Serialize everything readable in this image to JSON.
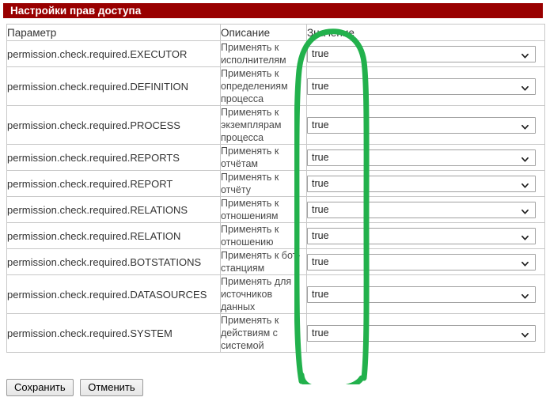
{
  "window": {
    "title": "Настройки прав доступа"
  },
  "table": {
    "headers": {
      "parameter": "Параметр",
      "description": "Описание",
      "value": "Значение"
    },
    "rows": [
      {
        "parameter": "permission.check.required.EXECUTOR",
        "description": "Применять к исполнителям",
        "value": "true"
      },
      {
        "parameter": "permission.check.required.DEFINITION",
        "description": "Применять к определениям процесса",
        "value": "true"
      },
      {
        "parameter": "permission.check.required.PROCESS",
        "description": "Применять к экземплярам процесса",
        "value": "true"
      },
      {
        "parameter": "permission.check.required.REPORTS",
        "description": "Применять к отчётам",
        "value": "true"
      },
      {
        "parameter": "permission.check.required.REPORT",
        "description": "Применять к отчёту",
        "value": "true"
      },
      {
        "parameter": "permission.check.required.RELATIONS",
        "description": "Применять к отношениям",
        "value": "true"
      },
      {
        "parameter": "permission.check.required.RELATION",
        "description": "Применять к отношению",
        "value": "true"
      },
      {
        "parameter": "permission.check.required.BOTSTATIONS",
        "description": "Применять к бот-станциям",
        "value": "true"
      },
      {
        "parameter": "permission.check.required.DATASOURCES",
        "description": "Применять для источников данных",
        "value": "true"
      },
      {
        "parameter": "permission.check.required.SYSTEM",
        "description": "Применять к действиям с системой",
        "value": "true"
      }
    ]
  },
  "buttons": {
    "save": "Сохранить",
    "cancel": "Отменить"
  },
  "annotation": {
    "shape": "ellipse-highlight",
    "color": "#22b14c",
    "target": "value-column"
  },
  "colors": {
    "title_bar": "#990000",
    "title_text": "#ffffff",
    "border": "#c8c8c8",
    "text": "#333333",
    "annotation_green": "#22b14c"
  },
  "icons": {
    "chevron_down": "chevron-down-icon"
  }
}
